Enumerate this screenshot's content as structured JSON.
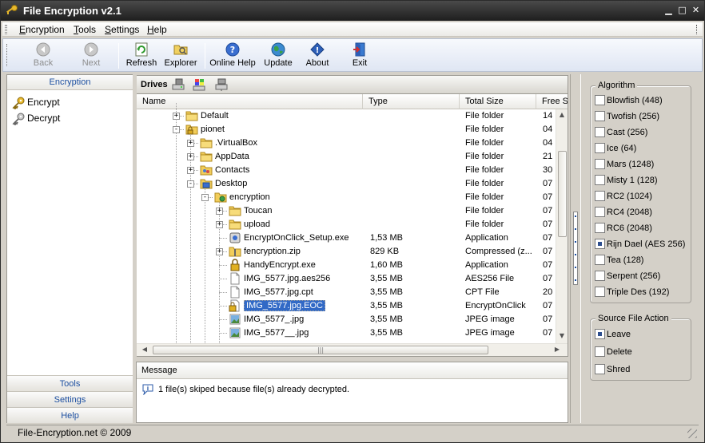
{
  "window": {
    "title": "File Encryption v2.1"
  },
  "menu": [
    {
      "pre": "",
      "u": "E",
      "post": "ncryption"
    },
    {
      "pre": "",
      "u": "T",
      "post": "ools"
    },
    {
      "pre": "",
      "u": "S",
      "post": "ettings"
    },
    {
      "pre": "",
      "u": "H",
      "post": "elp"
    }
  ],
  "toolbar": {
    "back": "Back",
    "next": "Next",
    "refresh": "Refresh",
    "explorer": "Explorer",
    "online_help": "Online Help",
    "update": "Update",
    "about": "About",
    "exit": "Exit"
  },
  "left_panel": {
    "header": "Encryption",
    "items": [
      "Encrypt",
      "Decrypt"
    ],
    "footer": [
      "Tools",
      "Settings",
      "Help"
    ]
  },
  "drives": {
    "label": "Drives"
  },
  "columns": [
    "Name",
    "Type",
    "Total Size",
    "Free S"
  ],
  "rows": [
    {
      "name": "Default",
      "size": "",
      "type": "File folder",
      "free": "14",
      "icon": "folder-icon",
      "level": 1,
      "exp": "+"
    },
    {
      "name": "pionet",
      "size": "",
      "type": "File folder",
      "free": "04",
      "icon": "locked-folder-icon",
      "level": 1,
      "exp": "-"
    },
    {
      "name": ".VirtualBox",
      "size": "",
      "type": "File folder",
      "free": "04",
      "icon": "folder-icon",
      "level": 2,
      "exp": "+"
    },
    {
      "name": "AppData",
      "size": "",
      "type": "File folder",
      "free": "21",
      "icon": "folder-icon",
      "level": 2,
      "exp": "+"
    },
    {
      "name": "Contacts",
      "size": "",
      "type": "File folder",
      "free": "30",
      "icon": "contacts-folder-icon",
      "level": 2,
      "exp": "+"
    },
    {
      "name": "Desktop",
      "size": "",
      "type": "File folder",
      "free": "07",
      "icon": "desktop-folder-icon",
      "level": 2,
      "exp": "-"
    },
    {
      "name": "encryption",
      "size": "",
      "type": "File folder",
      "free": "07",
      "icon": "encryption-folder-icon",
      "level": 3,
      "exp": "-"
    },
    {
      "name": "Toucan",
      "size": "",
      "type": "File folder",
      "free": "07",
      "icon": "folder-icon",
      "level": 4,
      "exp": "+"
    },
    {
      "name": "upload",
      "size": "",
      "type": "File folder",
      "free": "07",
      "icon": "folder-icon",
      "level": 4,
      "exp": "+"
    },
    {
      "name": "EncryptOnClick_Setup.exe",
      "size": "1,53 MB",
      "type": "Application",
      "free": "07",
      "icon": "setup-icon",
      "level": 4,
      "exp": ""
    },
    {
      "name": "fencryption.zip",
      "size": "829 KB",
      "type": "Compressed (z...",
      "free": "07",
      "icon": "zip-icon",
      "level": 4,
      "exp": "+"
    },
    {
      "name": "HandyEncrypt.exe",
      "size": "1,60 MB",
      "type": "Application",
      "free": "07",
      "icon": "lock-app-icon",
      "level": 4,
      "exp": ""
    },
    {
      "name": "IMG_5577.jpg.aes256",
      "size": "3,55 MB",
      "type": "AES256 File",
      "free": "07",
      "icon": "blank-file-icon",
      "level": 4,
      "exp": ""
    },
    {
      "name": "IMG_5577.jpg.cpt",
      "size": "3,55 MB",
      "type": "CPT File",
      "free": "20",
      "icon": "blank-file-icon",
      "level": 4,
      "exp": ""
    },
    {
      "name": "IMG_5577.jpg.EOC",
      "size": "3,55 MB",
      "type": "EncryptOnClick",
      "free": "07",
      "icon": "lock-file-icon",
      "level": 4,
      "exp": "",
      "selected": true
    },
    {
      "name": "IMG_5577_.jpg",
      "size": "3,55 MB",
      "type": "JPEG image",
      "free": "07",
      "icon": "image-file-icon",
      "level": 4,
      "exp": ""
    },
    {
      "name": "IMG_5577__.jpg",
      "size": "3,55 MB",
      "type": "JPEG image",
      "free": "07",
      "icon": "image-file-icon",
      "level": 4,
      "exp": ""
    }
  ],
  "message": {
    "header": "Message",
    "text": "1 file(s) skiped because file(s) already decrypted."
  },
  "algorithm": {
    "legend": "Algorithm",
    "options": [
      "Blowfish (448)",
      "Twofish (256)",
      "Cast (256)",
      "Ice (64)",
      "Mars (1248)",
      "Misty 1 (128)",
      "RC2 (1024)",
      "RC4 (2048)",
      "RC6 (2048)",
      "Rijn Dael (AES 256)",
      "Tea (128)",
      "Serpent (256)",
      "Triple Des (192)"
    ],
    "selected": "Rijn Dael (AES 256)"
  },
  "source_action": {
    "legend": "Source File Action",
    "options": [
      "Leave",
      "Delete",
      "Shred"
    ],
    "selected": "Leave"
  },
  "status": {
    "text": "File-Encryption.net  © 2009"
  },
  "colors": {
    "title_bar": "#2a2a2a",
    "selection": "#3169c6",
    "link_blue": "#1c4fa0"
  }
}
